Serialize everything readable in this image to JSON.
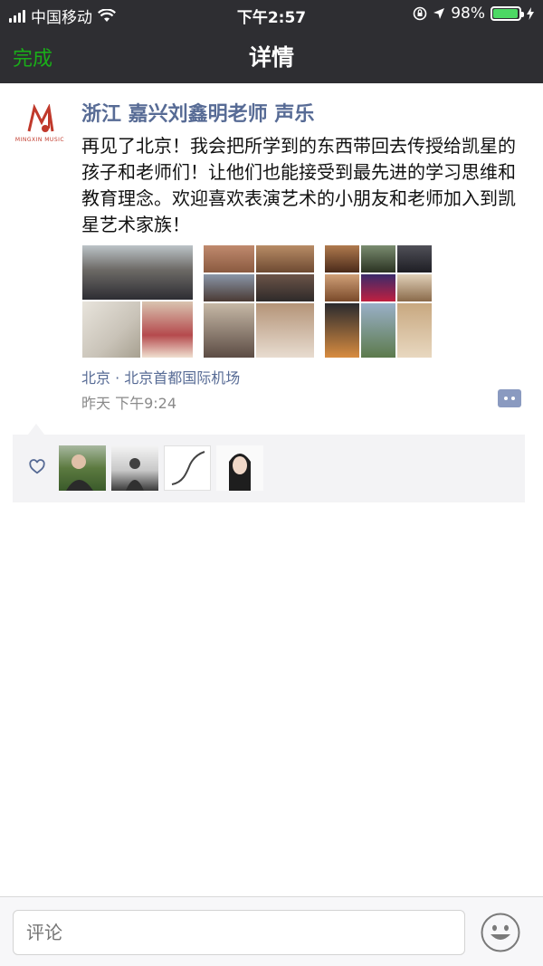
{
  "status": {
    "carrier": "中国移动",
    "time": "下午2:57",
    "battery_text": "98%",
    "battery_level": 0.98,
    "accent_green": "#4cd964"
  },
  "nav": {
    "done_label": "完成",
    "title": "详情"
  },
  "post": {
    "author": "浙江 嘉兴刘鑫明老师 声乐",
    "avatar_logo_text": "明鑫音乐",
    "avatar_logo_sub": "MINGXIN MUSIC",
    "content": "再见了北京！我会把所学到的东西带回去传授给凯星的孩子和老师们！让他们也能接受到最先进的学习思维和教育理念。欢迎喜欢表演艺术的小朋友和老师加入到凯星艺术家族！",
    "location": "北京 · 北京首都国际机场",
    "time": "昨天 下午9:24",
    "photo_count": 3
  },
  "likes": {
    "icon": "heart-outline-icon",
    "liker_count": 4
  },
  "comment_bar": {
    "placeholder": "评论",
    "emoji_icon": "smiley-icon"
  },
  "colors": {
    "link": "#576b95",
    "nav_bg": "#2e2e32",
    "done": "#1aad19"
  }
}
